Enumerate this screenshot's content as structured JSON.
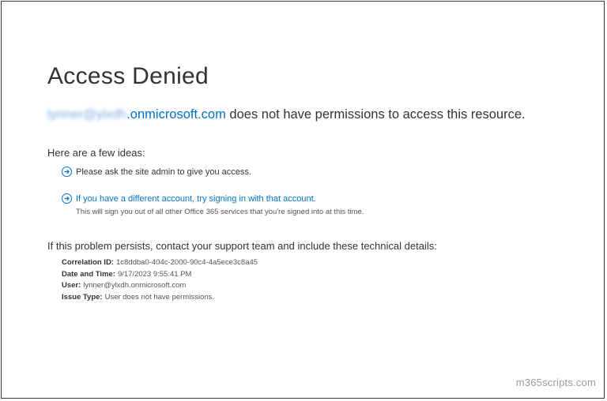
{
  "page": {
    "title": "Access Denied",
    "message": {
      "user_blurred": "lynner@ylxdh",
      "domain": ".onmicrosoft.com",
      "text": " does not have permissions to access this resource."
    },
    "ideas_heading": "Here are a few ideas:",
    "ideas": [
      {
        "text": "Please ask the site admin to give you access.",
        "icon": "circle-arrow-right-icon"
      },
      {
        "text": "If you have a different account, try signing in with that account.",
        "icon": "circle-arrow-right-icon",
        "note": "This will sign you out of all other Office 365 services that you're signed into at this time."
      }
    ],
    "persist_text": "If this problem persists, contact your support team and include these technical details:",
    "details": {
      "correlation_label": "Correlation ID:",
      "correlation_value": "1c8ddba0-404c-2000-90c4-4a5ece3c8a45",
      "datetime_label": "Date and Time:",
      "datetime_value": "9/17/2023 9:55:41 PM",
      "user_label": "User:",
      "user_value": "lynner@ylxdh.onmicrosoft.com",
      "issue_label": "Issue Type:",
      "issue_value": "User does not have permissions."
    },
    "watermark": "m365scripts.com"
  },
  "colors": {
    "link": "#0072c6",
    "text": "#333333",
    "muted": "#555555"
  }
}
